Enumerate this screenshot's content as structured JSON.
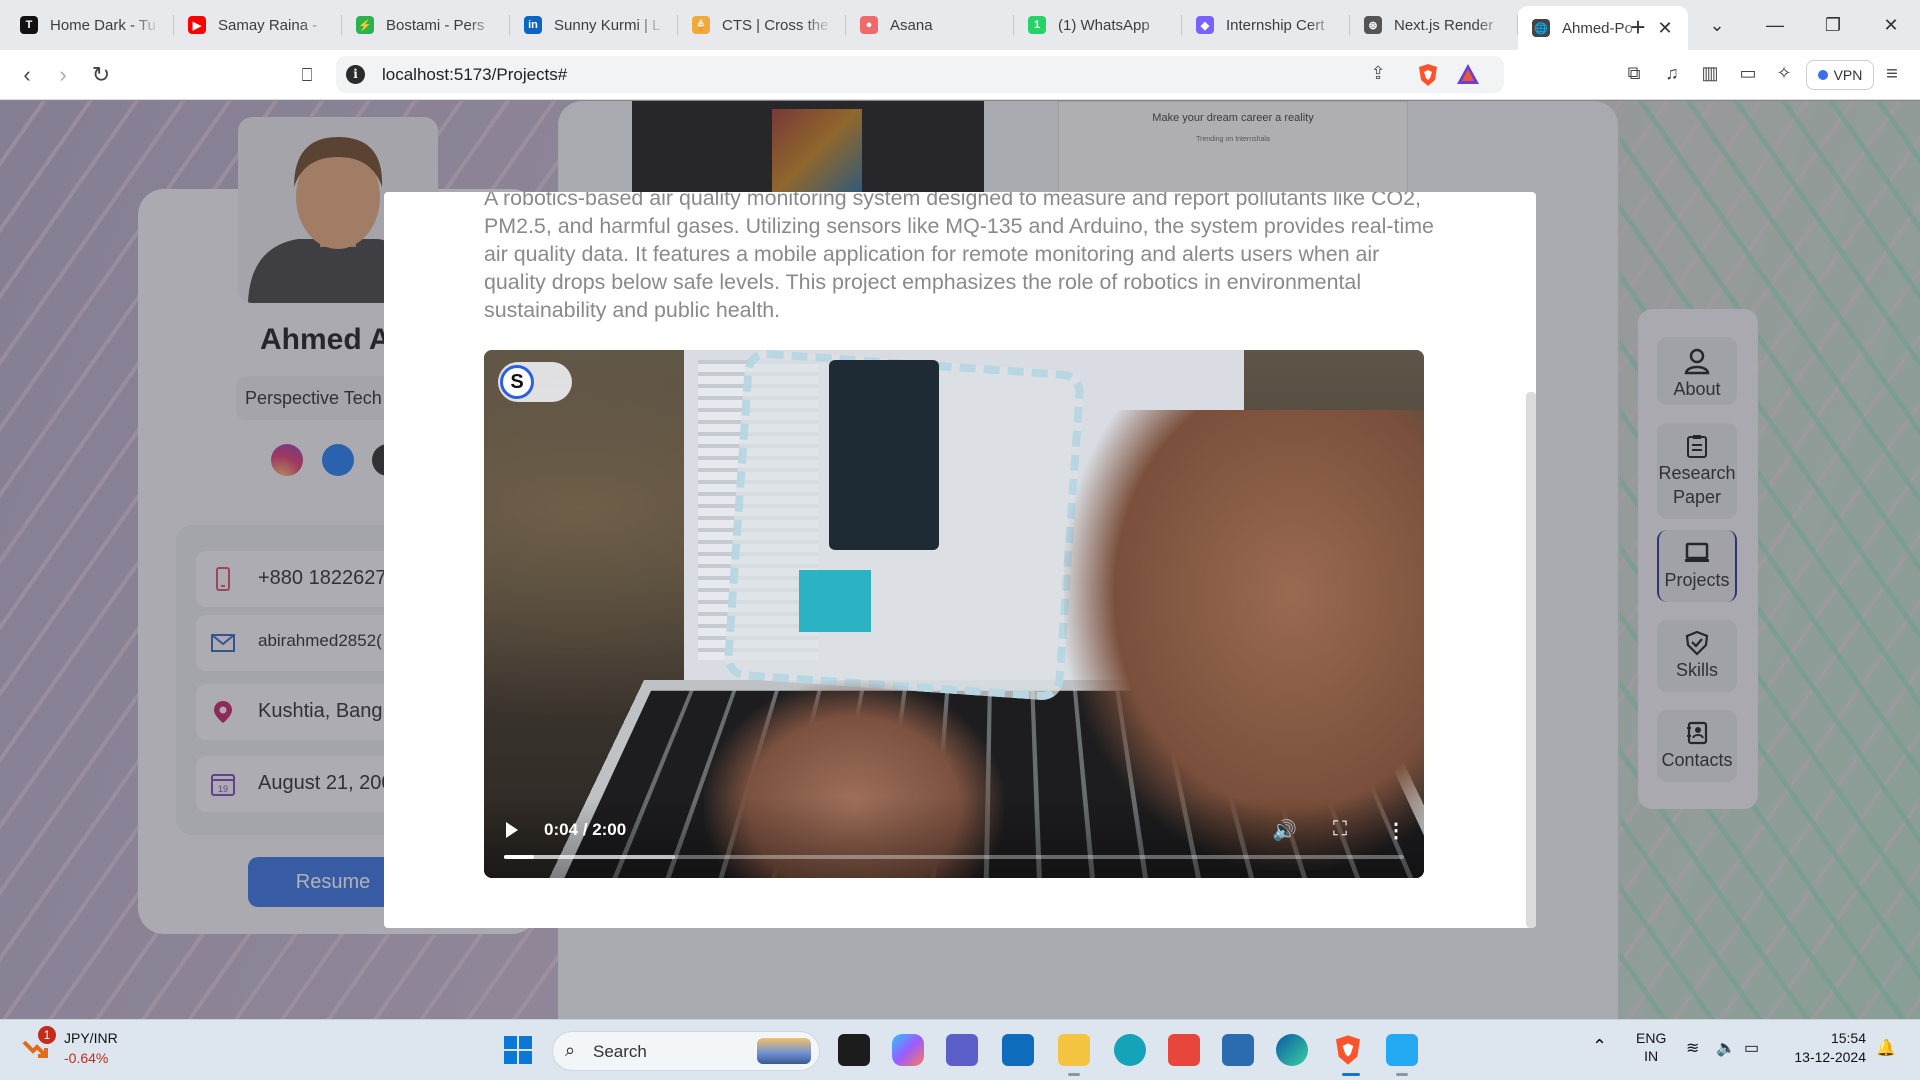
{
  "browser": {
    "tabs": [
      {
        "title": "Home Dark - Tu",
        "favicon": "T",
        "color": "#111111"
      },
      {
        "title": "Samay Raina -",
        "favicon": "▶",
        "color": "#ff0000"
      },
      {
        "title": "Bostami - Pers",
        "favicon": "⚡",
        "color": "#2bb24c"
      },
      {
        "title": "Sunny Kurmi | L",
        "favicon": "in",
        "color": "#0a66c2"
      },
      {
        "title": "CTS | Cross the",
        "favicon": "🍦",
        "color": "#f2a93b"
      },
      {
        "title": "Asana",
        "favicon": "●",
        "color": "#f06a6a"
      },
      {
        "title": "(1) WhatsApp",
        "favicon": "1",
        "color": "#25d366"
      },
      {
        "title": "Internship Cert",
        "favicon": "◆",
        "color": "#7b61ff"
      },
      {
        "title": "Next.js Render",
        "favicon": "⊛",
        "color": "#555555"
      },
      {
        "title": "Ahmed-Po",
        "favicon": "🌐",
        "color": "#444444",
        "active": true
      }
    ],
    "url": "localhost:5173/Projects#",
    "vpn_label": "VPN"
  },
  "profile": {
    "name": "Ahmed Al",
    "role": "Perspective Tech",
    "contacts": [
      {
        "icon": "phone-icon",
        "text": "+880 18226277"
      },
      {
        "icon": "mail-icon",
        "text": "abirahmed2852("
      },
      {
        "icon": "location-pin-icon",
        "text": "Kushtia, Bang"
      },
      {
        "icon": "calendar-icon",
        "text": "August 21, 200"
      }
    ],
    "resume_label": "Resume"
  },
  "thumbs": {
    "right_caption": "Make your dream career a reality",
    "right_sub": "Trending on Internshala"
  },
  "sidenav": [
    {
      "label": "About",
      "icon": "user-icon"
    },
    {
      "label": "Research\nPaper",
      "icon": "clipboard-icon"
    },
    {
      "label": "Projects",
      "icon": "laptop-icon",
      "active": true
    },
    {
      "label": "Skills",
      "icon": "shield-check-icon"
    },
    {
      "label": "Contacts",
      "icon": "address-book-icon"
    }
  ],
  "modal": {
    "description": "A robotics-based air quality monitoring system designed to measure and report pollutants like CO2, PM2.5, and harmful gases. Utilizing sensors like MQ-135 and Arduino, the system provides real-time air quality data. It features a mobile application for remote monitoring and alerts users when air quality drops below safe levels. This project emphasizes the role of robotics in environmental sustainability and public health.",
    "video": {
      "time": "0:04 / 2:00",
      "progress_fraction": 0.033,
      "buffered_fraction": 0.19,
      "badge_letter": "S"
    }
  },
  "taskbar": {
    "ticker_name": "JPY/INR",
    "ticker_change": "-0.64%",
    "ticker_badge": "1",
    "search_label": "Search",
    "lang_top": "ENG",
    "lang_bottom": "IN",
    "time": "15:54",
    "date": "13-12-2024"
  }
}
